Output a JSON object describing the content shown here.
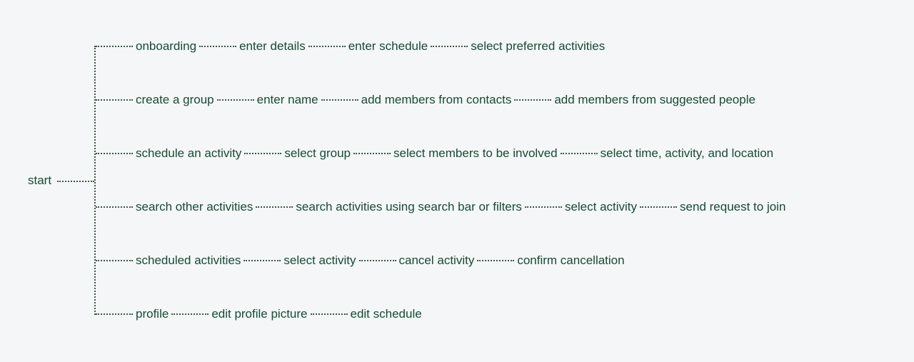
{
  "root": "start",
  "branches": [
    {
      "steps": [
        "onboarding",
        "enter details",
        "enter schedule",
        "select preferred activities"
      ]
    },
    {
      "steps": [
        "create a group",
        "enter name",
        "add members from contacts",
        "add members from suggested people"
      ]
    },
    {
      "steps": [
        "schedule an activity",
        "select group",
        "select members to be involved",
        "select time, activity, and location"
      ]
    },
    {
      "steps": [
        "search other activities",
        "search activities using search bar or filters",
        "select activity",
        "send request to join"
      ]
    },
    {
      "steps": [
        "scheduled activities",
        "select activity",
        "cancel activity",
        "confirm cancellation"
      ]
    },
    {
      "steps": [
        "profile",
        "edit profile picture",
        "edit schedule"
      ]
    }
  ]
}
